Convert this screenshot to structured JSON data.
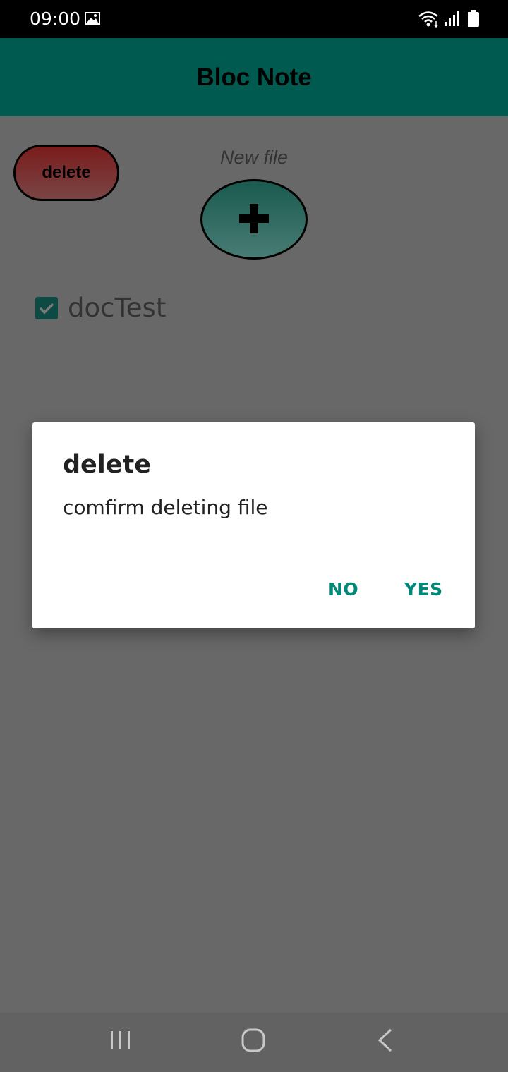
{
  "status_bar": {
    "time": "09:00",
    "icons": [
      "gallery-icon",
      "wifi-icon",
      "signal-icon",
      "battery-icon"
    ]
  },
  "app_bar": {
    "title": "Bloc Note",
    "color": "#009688"
  },
  "toolbar": {
    "delete_label": "delete",
    "new_file_label": "New file",
    "add_icon": "plus-icon"
  },
  "files": [
    {
      "name": "docTest",
      "checked": true
    }
  ],
  "dialog": {
    "title": "delete",
    "message": "comfirm deleting file",
    "no_label": "NO",
    "yes_label": "YES",
    "accent_color": "#00897b"
  },
  "nav_bar": {
    "icons": [
      "recent-apps-icon",
      "home-icon",
      "back-icon"
    ]
  }
}
